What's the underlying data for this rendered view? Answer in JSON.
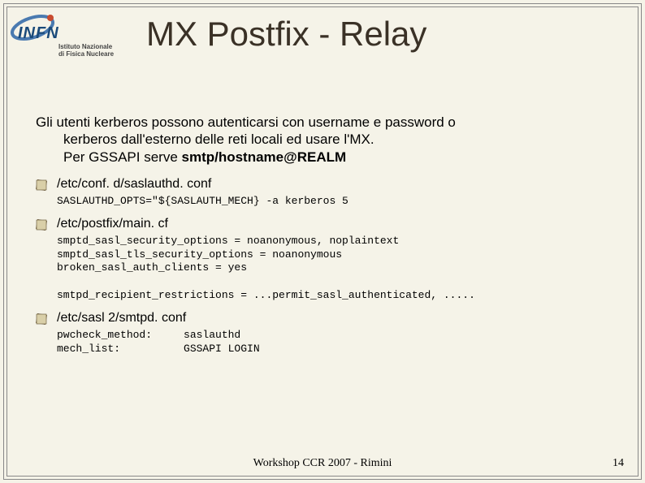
{
  "logo": {
    "acronym": "INFN",
    "subtitle_line1": "Istituto Nazionale",
    "subtitle_line2": "di Fisica Nucleare"
  },
  "title": "MX Postfix - Relay",
  "intro": {
    "line1": "Gli utenti kerberos possono autenticarsi con username e password o",
    "line2": "kerberos dall'esterno delle reti locali ed usare l'MX.",
    "line3_prefix": "Per GSSAPI serve ",
    "line3_bold": "smtp/hostname@REALM"
  },
  "sections": [
    {
      "file": "/etc/conf. d/saslauthd. conf",
      "code": "SASLAUTHD_OPTS=\"${SASLAUTH_MECH} -a kerberos 5"
    },
    {
      "file": "/etc/postfix/main. cf",
      "code": "smptd_sasl_security_options = noanonymous, noplaintext\nsmptd_sasl_tls_security_options = noanonymous\nbroken_sasl_auth_clients = yes\n\nsmtpd_recipient_restrictions = ...permit_sasl_authenticated, ....."
    },
    {
      "file": "/etc/sasl 2/smtpd. conf",
      "code": "pwcheck_method:     saslauthd\nmech_list:          GSSAPI LOGIN"
    }
  ],
  "footer": "Workshop CCR 2007 - Rimini",
  "pagenum": "14"
}
